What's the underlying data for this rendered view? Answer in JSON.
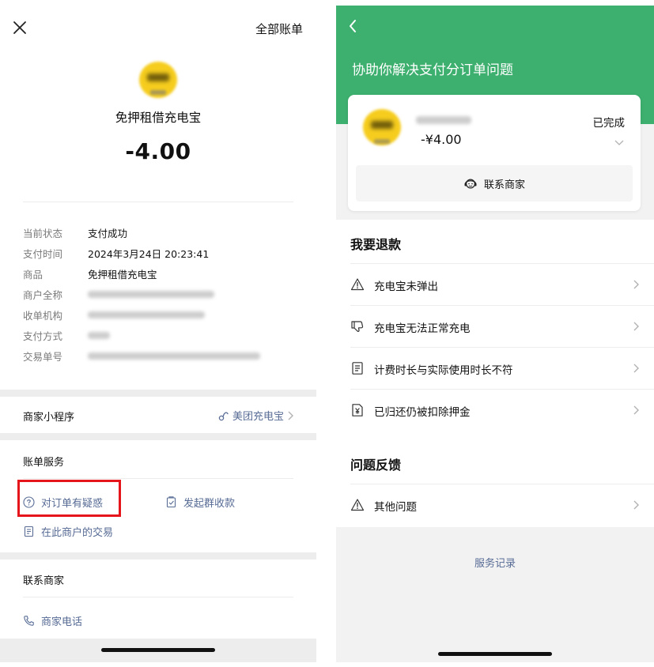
{
  "left": {
    "header": {
      "all_bills": "全部账单"
    },
    "product_name": "免押租借充电宝",
    "amount": "-4.00",
    "info": [
      {
        "label": "当前状态",
        "value": "支付成功"
      },
      {
        "label": "支付时间",
        "value": "2024年3月24日 20:23:41"
      },
      {
        "label": "商品",
        "value": "免押租借充电宝"
      },
      {
        "label": "商户全称",
        "value": ""
      },
      {
        "label": "收单机构",
        "value": ""
      },
      {
        "label": "支付方式",
        "value": ""
      },
      {
        "label": "交易单号",
        "value": ""
      }
    ],
    "mini_program": {
      "label": "商家小程序",
      "name": "美团充电宝"
    },
    "bill_service": {
      "title": "账单服务",
      "question_order": "对订单有疑惑",
      "group_collect": "发起群收款",
      "merchant_trades": "在此商户的交易"
    },
    "contact": {
      "title": "联系商家",
      "phone": "商家电话"
    },
    "colors": {
      "link": "#576b95",
      "highlight": "#e6151b",
      "logo": "#f6cd1e"
    }
  },
  "right": {
    "title": "协助你解决支付分订单问题",
    "card": {
      "amount": "-¥4.00",
      "status": "已完成",
      "contact_label": "联系商家"
    },
    "refund_section": {
      "title": "我要退款",
      "items": [
        {
          "label": "充电宝未弹出",
          "icon": "warning-icon"
        },
        {
          "label": "充电宝无法正常充电",
          "icon": "thumbs-down-icon"
        },
        {
          "label": "计费时长与实际使用时长不符",
          "icon": "document-icon"
        },
        {
          "label": "已归还仍被扣除押金",
          "icon": "yuan-document-icon"
        }
      ]
    },
    "feedback_section": {
      "title": "问题反馈",
      "items": [
        {
          "label": "其他问题",
          "icon": "warning-icon"
        }
      ]
    },
    "service_records": "服务记录",
    "colors": {
      "header": "#3daf6e",
      "link": "#576b95"
    }
  }
}
